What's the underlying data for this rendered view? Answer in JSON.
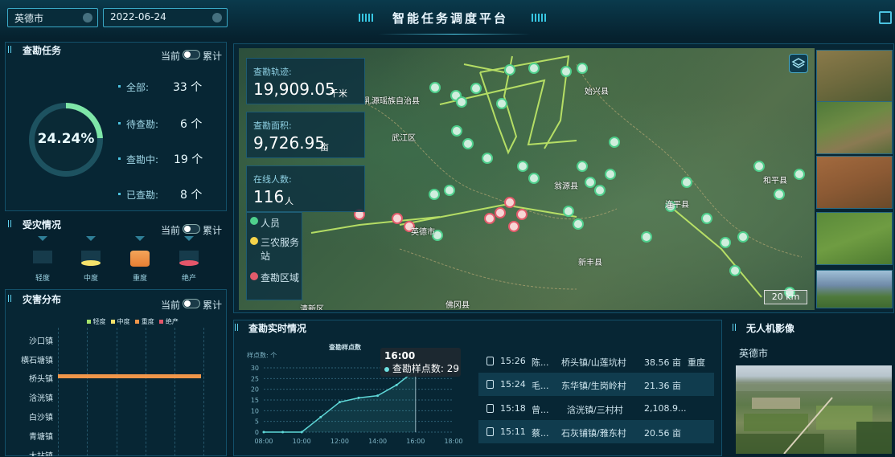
{
  "header": {
    "title": "智能任务调度平台",
    "city_select": "英德市",
    "date_select": "2022-06-24"
  },
  "survey_task": {
    "title": "查勘任务",
    "toggle_left": "当前",
    "toggle_right": "累计",
    "percent": "24.24%",
    "percent_value": 0.2424,
    "stats": [
      {
        "label": "全部:",
        "value": "33 个"
      },
      {
        "label": "待查勘:",
        "value": "6 个"
      },
      {
        "label": "查勘中:",
        "value": "19 个"
      },
      {
        "label": "已查勘:",
        "value": "8 个"
      }
    ]
  },
  "damage_status": {
    "title": "受灾情况",
    "toggle_left": "当前",
    "toggle_right": "累计",
    "levels": [
      {
        "label": "轻度",
        "color": "#2c5a68"
      },
      {
        "label": "中度",
        "color": "#f5e26b"
      },
      {
        "label": "重度",
        "color": "#f0964a"
      },
      {
        "label": "绝产",
        "color": "#e4566a"
      }
    ]
  },
  "disaster_dist": {
    "title": "灾害分布",
    "toggle_left": "当前",
    "toggle_right": "累计",
    "legend": [
      {
        "label": "轻度",
        "color": "#a6e36b"
      },
      {
        "label": "中度",
        "color": "#f5e26b"
      },
      {
        "label": "重度",
        "color": "#f0964a"
      },
      {
        "label": "绝产",
        "color": "#e4566a"
      }
    ],
    "towns": [
      "沙口镇",
      "横石塘镇",
      "桥头镇",
      "浛洸镇",
      "白沙镇",
      "青塘镇",
      "大站镇"
    ],
    "bar_town_index": 2,
    "bar_color": "#f0964a"
  },
  "map": {
    "overlays": [
      {
        "label": "查勘轨迹:",
        "value": "19,909.05",
        "unit": "千米"
      },
      {
        "label": "查勘面积:",
        "value": "9,726.95",
        "unit": "亩"
      },
      {
        "label": "在线人数:",
        "value": "116",
        "unit": "人"
      }
    ],
    "legend": [
      {
        "label": "人员",
        "icon": "person-pin-icon"
      },
      {
        "label": "三农服务站",
        "icon": "service-station-icon"
      },
      {
        "label": "查勘区域",
        "icon": "survey-area-icon"
      }
    ],
    "place_labels": [
      "乳源瑶族自治县",
      "武江区",
      "始兴县",
      "翁源县",
      "和平县",
      "连平县",
      "新丰县",
      "佛冈县",
      "清新区",
      "英德市"
    ],
    "scale": "20 km"
  },
  "realtime": {
    "title": "查勘实时情况",
    "chart_title": "查勘样点数",
    "tooltip_time": "16:00",
    "tooltip_label": "查勘样点数:",
    "tooltip_value": "29",
    "records": [
      {
        "time": "15:26",
        "name": "陈...",
        "place": "桥头镇/山莲坑村",
        "area": "38.56 亩",
        "level": "重度"
      },
      {
        "time": "15:24",
        "name": "毛...",
        "place": "东华镇/生岗岭村",
        "area": "21.36 亩",
        "level": ""
      },
      {
        "time": "15:18",
        "name": "曾...",
        "place": "浛洸镇/三村村",
        "area": "2,108.9...",
        "level": ""
      },
      {
        "time": "15:11",
        "name": "蔡...",
        "place": "石灰铺镇/雅东村",
        "area": "20.56 亩",
        "level": ""
      }
    ]
  },
  "drone": {
    "title": "无人机影像",
    "location": "英德市"
  },
  "chart_data": {
    "type": "area",
    "title": "查勘样点数",
    "xlabel": "",
    "ylabel": "样点数: 个",
    "x": [
      "08:00",
      "09:00",
      "10:00",
      "11:00",
      "12:00",
      "13:00",
      "14:00",
      "15:00",
      "16:00"
    ],
    "values": [
      0,
      0,
      0,
      7,
      14,
      16,
      17,
      22,
      29
    ],
    "x_ticks": [
      "08:00",
      "10:00",
      "12:00",
      "14:00",
      "16:00",
      "18:00"
    ],
    "y_ticks": [
      0,
      5,
      10,
      15,
      20,
      25,
      30
    ],
    "xlim": [
      "08:00",
      "18:00"
    ],
    "ylim": [
      0,
      30
    ],
    "grid": true,
    "highlight_x": "16:00"
  }
}
